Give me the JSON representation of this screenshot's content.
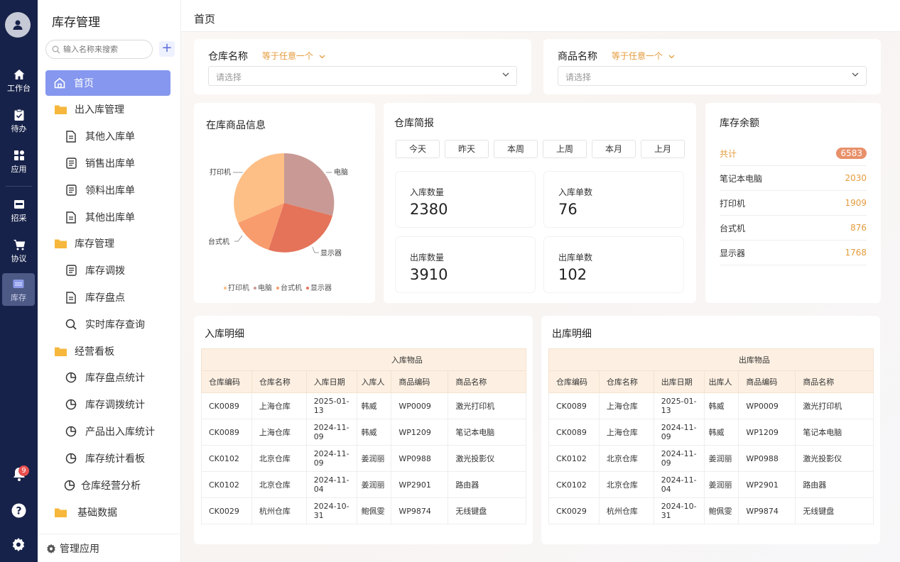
{
  "rail": {
    "items": [
      {
        "label": "工作台",
        "icon": "home-icon"
      },
      {
        "label": "待办",
        "icon": "clipboard-icon"
      },
      {
        "label": "应用",
        "icon": "apps-icon"
      },
      {
        "label": "招采",
        "icon": "procure-icon"
      },
      {
        "label": "协议",
        "icon": "cart-icon"
      },
      {
        "label": "库存",
        "icon": "warehouse-icon"
      }
    ],
    "notification_count": "9"
  },
  "sidebar": {
    "title": "库存管理",
    "search_placeholder": "输入名称来搜索",
    "items": [
      {
        "label": "首页"
      },
      {
        "label": "出入库管理"
      },
      {
        "label": "其他入库单"
      },
      {
        "label": "销售出库单"
      },
      {
        "label": "领料出库单"
      },
      {
        "label": "其他出库单"
      },
      {
        "label": "库存管理"
      },
      {
        "label": "库存调拨"
      },
      {
        "label": "库存盘点"
      },
      {
        "label": "实时库存查询"
      },
      {
        "label": "经营看板"
      },
      {
        "label": "库存盘点统计"
      },
      {
        "label": "库存调拨统计"
      },
      {
        "label": "产品出入库统计"
      },
      {
        "label": "库存统计看板"
      },
      {
        "label": "仓库经营分析"
      },
      {
        "label": "基础数据"
      }
    ],
    "manage_label": "管理应用"
  },
  "header": {
    "title": "首页"
  },
  "filters": {
    "warehouse": {
      "label": "仓库名称",
      "op": "等于任意一个",
      "placeholder": "请选择"
    },
    "product": {
      "label": "商品名称",
      "op": "等于任意一个",
      "placeholder": "请选择"
    }
  },
  "pie": {
    "title": "在库商品信息",
    "colors": {
      "打印机": "#fdbf86",
      "电脑": "#c99a95",
      "台式机": "#f89c6e",
      "显示器": "#e4735a"
    },
    "legend": [
      "打印机",
      "电脑",
      "台式机",
      "显示器"
    ],
    "labels": {
      "printer": "打印机",
      "pc": "电脑",
      "desktop": "台式机",
      "monitor": "显示器"
    }
  },
  "brief": {
    "title": "仓库简报",
    "periods": [
      "今天",
      "昨天",
      "本周",
      "上周",
      "本月",
      "上月"
    ],
    "stats": [
      {
        "label": "入库数量",
        "value": "2380"
      },
      {
        "label": "入库单数",
        "value": "76"
      },
      {
        "label": "出库数量",
        "value": "3910"
      },
      {
        "label": "出库单数",
        "value": "102"
      }
    ]
  },
  "balance": {
    "title": "库存余额",
    "rows": [
      {
        "name": "共计",
        "value": "6583"
      },
      {
        "name": "笔记本电脑",
        "value": "2030"
      },
      {
        "name": "打印机",
        "value": "1909"
      },
      {
        "name": "台式机",
        "value": "876"
      },
      {
        "name": "显示器",
        "value": "1768"
      }
    ]
  },
  "inbound": {
    "title": "入库明细",
    "group": "入库物品",
    "columns": [
      "仓库编码",
      "仓库名称",
      "入库日期",
      "入库人",
      "商品编码",
      "商品名称"
    ],
    "rows": [
      [
        "CK0089",
        "上海仓库",
        "2025-01-13",
        "韩威",
        "WP0009",
        "激光打印机"
      ],
      [
        "CK0089",
        "上海仓库",
        "2024-11-09",
        "韩威",
        "WP1209",
        "笔记本电脑"
      ],
      [
        "CK0102",
        "北京仓库",
        "2024-11-09",
        "姜润丽",
        "WP0988",
        "激光投影仪"
      ],
      [
        "CK0102",
        "北京仓库",
        "2024-11-04",
        "姜润丽",
        "WP2901",
        "路由器"
      ],
      [
        "CK0029",
        "杭州仓库",
        "2024-10-31",
        "鲍佩雯",
        "WP9874",
        "无线键盘"
      ]
    ]
  },
  "outbound": {
    "title": "出库明细",
    "group": "出库物品",
    "columns": [
      "仓库编码",
      "仓库名称",
      "出库日期",
      "出库人",
      "商品编码",
      "商品名称"
    ],
    "rows": [
      [
        "CK0089",
        "上海仓库",
        "2025-01-13",
        "韩威",
        "WP0009",
        "激光打印机"
      ],
      [
        "CK0089",
        "上海仓库",
        "2024-11-09",
        "韩威",
        "WP1209",
        "笔记本电脑"
      ],
      [
        "CK0102",
        "北京仓库",
        "2024-11-09",
        "姜润丽",
        "WP0988",
        "激光投影仪"
      ],
      [
        "CK0102",
        "北京仓库",
        "2024-11-04",
        "姜润丽",
        "WP2901",
        "路由器"
      ],
      [
        "CK0029",
        "杭州仓库",
        "2024-10-31",
        "鲍佩雯",
        "WP9874",
        "无线键盘"
      ]
    ]
  }
}
